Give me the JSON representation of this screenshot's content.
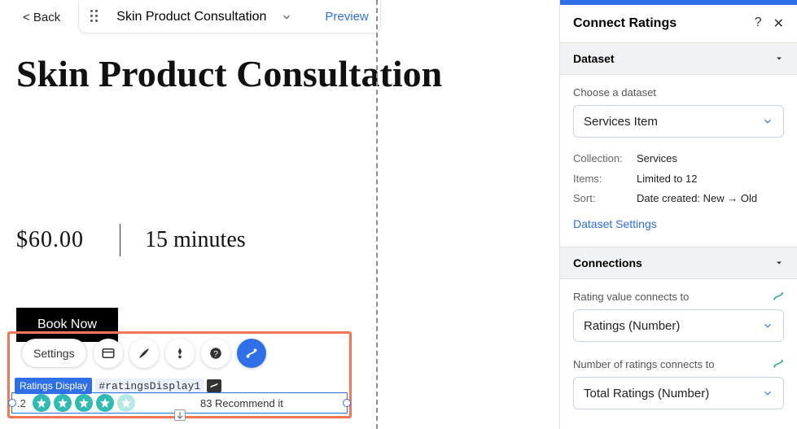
{
  "topbar": {
    "back_label": "< Back",
    "page_name": "Skin Product Consultation",
    "preview_label": "Preview"
  },
  "page": {
    "heading": "Skin Product Consultation",
    "price": "$60.00",
    "duration": "15 minutes",
    "book_label": "Book Now"
  },
  "selection": {
    "settings_label": "Settings",
    "element_tag": "Ratings Display",
    "element_id": "#ratingsDisplay1",
    "rating_value": ".2",
    "recommend_label": "83 Recommend it"
  },
  "panel": {
    "title": "Connect Ratings",
    "sections": {
      "dataset": {
        "title": "Dataset",
        "choose_label": "Choose a dataset",
        "selected": "Services Item",
        "meta": {
          "collection_key": "Collection:",
          "collection_val": "Services",
          "items_key": "Items:",
          "items_val": "Limited to 12",
          "sort_key": "Sort:",
          "sort_val": "Date created: New → Old"
        },
        "settings_link": "Dataset Settings"
      },
      "connections": {
        "title": "Connections",
        "rating_label": "Rating value connects to",
        "rating_selected": "Ratings (Number)",
        "count_label": "Number of ratings connects to",
        "count_selected": "Total Ratings (Number)"
      }
    }
  }
}
